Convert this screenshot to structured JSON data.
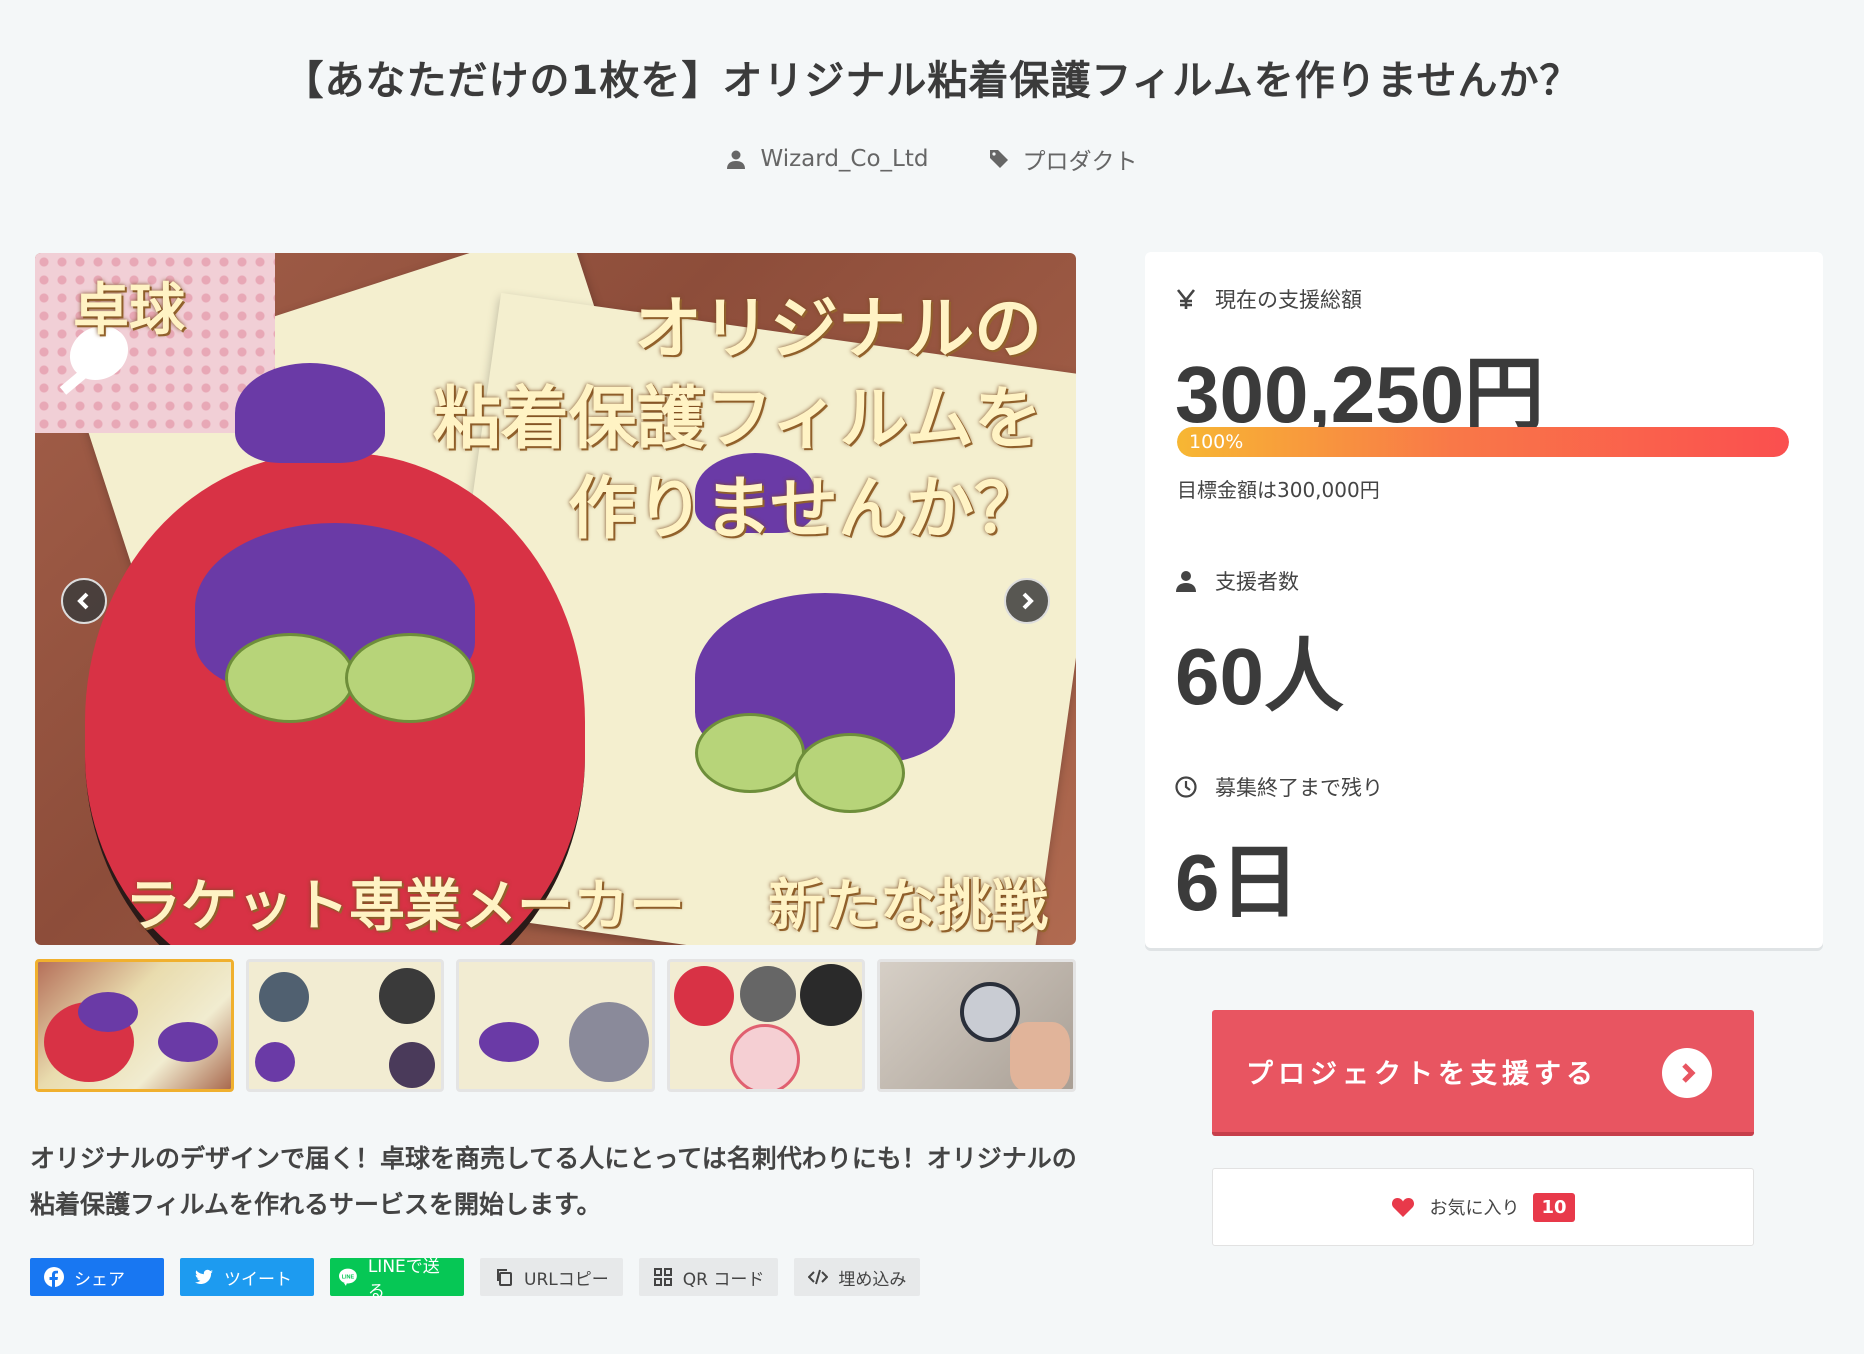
{
  "title": "【あなただけの1枚を】オリジナル粘着保護フィルムを作りませんか？",
  "meta": {
    "author": "Wizard_Co_Ltd",
    "category": "プロダクト"
  },
  "main_image": {
    "badge": "卓球",
    "headline_line1": "オリジナルの",
    "headline_line2": "粘着保護フィルムを",
    "headline_line3": "作りませんか？",
    "footer_left": "ラケット専業メーカー",
    "footer_right": "新たな挑戦"
  },
  "description": "オリジナルのデザインで届く！卓球を商売してる人にとっては名刺代わりにも！オリジナルの粘着保護フィルムを作れるサービスを開始します。",
  "share": {
    "facebook": "シェア",
    "twitter": "ツイート",
    "line": "LINEで送る",
    "url_copy": "URLコピー",
    "qr": "QR コード",
    "embed": "埋め込み"
  },
  "stats": {
    "total_label": "現在の支援総額",
    "total_value": "300,250円",
    "progress_text": "100%",
    "progress": 1.0,
    "goal_text": "目標金額は300,000円",
    "backers_label": "支援者数",
    "backers_value": "60人",
    "remaining_label": "募集終了まで残り",
    "remaining_value": "6日"
  },
  "support_button": "プロジェクトを支援する",
  "favorite": {
    "label": "お気に入り",
    "count": "10"
  },
  "colors": {
    "accent": "#e85561",
    "facebook": "#1877f2",
    "twitter": "#1d9bf0",
    "line": "#06c755"
  }
}
